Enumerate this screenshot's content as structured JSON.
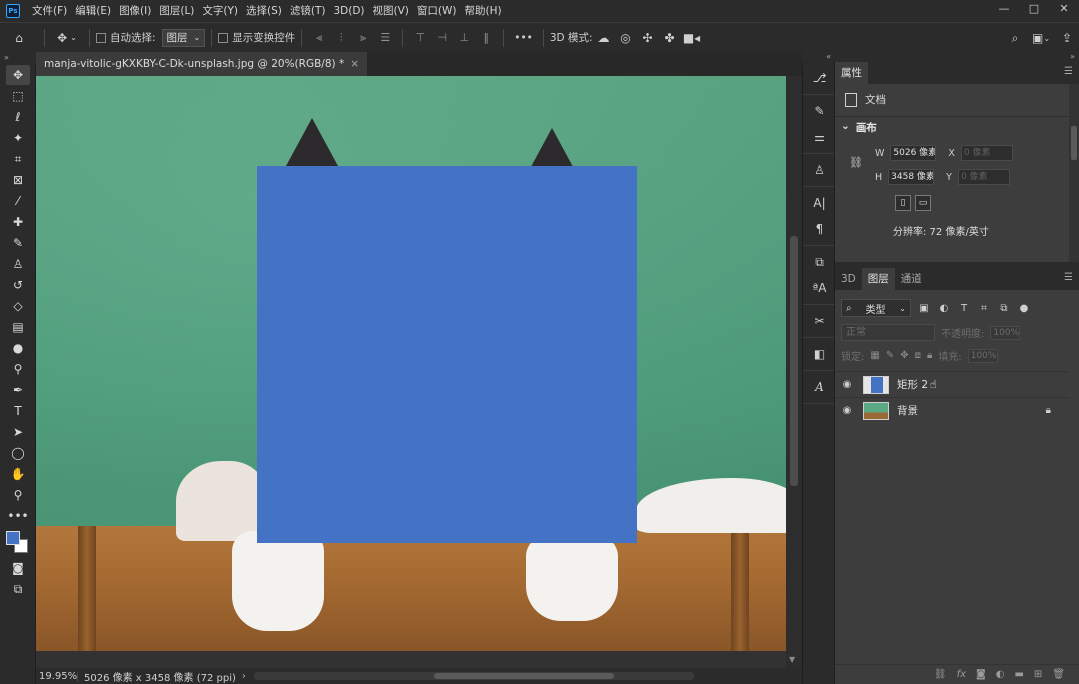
{
  "app": {
    "logo": "Ps"
  },
  "menu": [
    "文件(F)",
    "编辑(E)",
    "图像(I)",
    "图层(L)",
    "文字(Y)",
    "选择(S)",
    "滤镜(T)",
    "3D(D)",
    "视图(V)",
    "窗口(W)",
    "帮助(H)"
  ],
  "window_controls": {
    "minimize": "—",
    "maximize": "□",
    "close": "✕"
  },
  "options_bar": {
    "auto_select_label": "自动选择:",
    "auto_select_value": "图层",
    "show_transform_label": "显示变换控件",
    "more": "•••",
    "mode_3d_label": "3D 模式:"
  },
  "document": {
    "tab_title": "manja-vitolic-gKXKBY-C-Dk-unsplash.jpg @ 20%(RGB/8) *",
    "close": "×"
  },
  "status": {
    "zoom": "19.95%",
    "doc_info": "5026 像素 x 3458 像素 (72 ppi)",
    "arrow": "›"
  },
  "properties": {
    "tab": "属性",
    "type_label": "文档",
    "canvas_section": "画布",
    "w_label": "W",
    "w_value": "5026 像素",
    "h_label": "H",
    "h_value": "3458 像素",
    "x_label": "X",
    "x_placeholder": "0 像素",
    "y_label": "Y",
    "y_placeholder": "0 像素",
    "resolution": "分辨率: 72 像素/英寸"
  },
  "layers_panel": {
    "tabs": [
      "3D",
      "图层",
      "通道"
    ],
    "active_tab": "图层",
    "filter_label": "类型",
    "blend_mode": "正常",
    "opacity_label": "不透明度:",
    "opacity_value": "100%",
    "lock_label": "锁定:",
    "fill_label": "填充:",
    "fill_value": "100%",
    "layers": [
      {
        "name": "矩形 2",
        "visible": true,
        "locked": false
      },
      {
        "name": "背景",
        "visible": true,
        "locked": true
      }
    ]
  },
  "colors": {
    "foreground": "#4472c4",
    "background": "#ffffff",
    "shape_fill": "#4472c4",
    "wall": "#5aa884",
    "accent": "#31a8ff"
  }
}
